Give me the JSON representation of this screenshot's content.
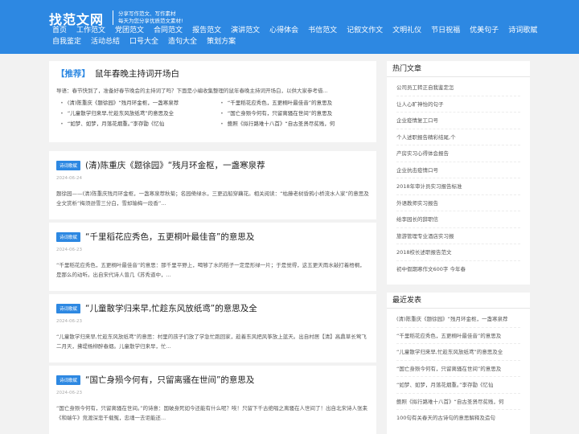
{
  "header": {
    "logo": "找范文网",
    "slogan_1": "分享写作范文、写作素材",
    "slogan_2": "每天为您分享优质范文素材!",
    "nav_row_1": [
      "首页",
      "工作范文",
      "党团范文",
      "合同范文",
      "报告范文",
      "演讲范文",
      "心得体会",
      "书信范文",
      "记叙文作文",
      "文明礼仪",
      "节日祝福",
      "优美句子",
      "诗词歌赋"
    ],
    "nav_row_2": [
      "自我鉴定",
      "活动总结",
      "口号大全",
      "造句大全",
      "策划方案"
    ]
  },
  "featured": {
    "tag": "【推荐】",
    "title": "鼠年春晚主持词开场白",
    "desc": "导语：春节快到了，准备好春节晚会的主持词了吗？下面是小编收集整理的鼠年春晚主持词开场白，以供大家参考借...",
    "links": [
      "(清)陈重庆《题徐园》“残月环金枢，一盏寒泉荐",
      "“千里稻花应秀色，五更桐叶最佳音”的意思及",
      "“儿童散学归来早,忙趁东风放纸鸢”的意思及全",
      "“国亡身殒今何有，只留离骚在世间”的意思及",
      "“如梦、如梦，月落花烟重。”李存勖《忆仙",
      "鲍照《拟行路难十八首》“自古圣贤尽贫贱，何"
    ]
  },
  "articles": [
    {
      "badge": "诗词歌赋",
      "title": "(清)陈重庆《题徐园》“残月环金枢，一盏寒泉荐",
      "date": "2024-06-24",
      "summary": "题徐园——(清)陈重庆残月环金枢，一盏寒泉荐秋菊；名园倚绿水，三更远船穿藕花。相关阅读：“枯藤老树昏鸦小桥流水人家”的意思及全文赏析“梅须逊雪三分白，雪却输梅一段香”..."
    },
    {
      "badge": "诗词歌赋",
      "title": "“千里稻花应秀色，五更桐叶最佳音”的意思及",
      "date": "2024-06-23",
      "summary": "“千里稻花应秀色，五更桐叶最佳音”的意思：那千里平野上，喝够了水的稻子一定是形绿一片；于是觉得，这五更天雨水敲打着梧桐，是那么的动听。出自宋代诗人曾几《苏秀道中，..."
    },
    {
      "badge": "诗词歌赋",
      "title": "“儿童散学归来早,忙趁东风放纸鸢”的意思及全",
      "date": "2024-06-23",
      "summary": "“儿童散学归来早,忙趁东风放纸鸢”的意思：村里的孩子们放了学急忙跑回家，趁着东风把风筝放上蓝天。出自村居【清】高鼎草长莺飞二月天，拂堤杨柳醉春烟。儿童散学归来早，忙..."
    },
    {
      "badge": "诗词歌赋",
      "title": "“国亡身殒今何有，只留离骚在世间”的意思及",
      "date": "2024-06-23",
      "summary": "“国亡身殒今何有，只留离骚在世间。”的诗意：国破身死如今还能有什么呢？唉！只留下千古绝唱之离骚在人世间了！出自北宋诗人张耒《和端午》竞渡深悲千载冤，忠魂一去讵能还..."
    }
  ],
  "sidebar": {
    "hot_title": "热门文章",
    "hot_items": [
      "公司员工转正自我鉴定怎",
      "让人心旷神怡的句子",
      "企业疫情复工口号",
      "个人述职报告精彩结尾,个",
      "产房实习心得体会报告",
      "企业抗击疫情口号",
      "2018年审计员实习报告标准",
      "外语教师实习报告",
      "给李园长的辞职信",
      "旅游管理专业酒店实习报",
      "2018校长述职报告范文",
      "初中假期寒作文600字 今年春"
    ],
    "recent_title": "最近发表",
    "recent_items": [
      "(清)陈重庆《题徐园》“残月环金枢，一盏寒泉荐",
      "“千里稻花应秀色，五更桐叶最佳音”的意思及",
      "“儿童散学归来早,忙趁东风放纸鸢”的意思及全",
      "“国亡身殒今何有，只留离骚在世间”的意思及",
      "“如梦、如梦，月落花烟重。”李存勖《忆仙",
      "鲍照《拟行路难十八首》“自古圣贤尽贫贱，何",
      "100句有关春天的古诗句的意思解释及造句"
    ]
  }
}
